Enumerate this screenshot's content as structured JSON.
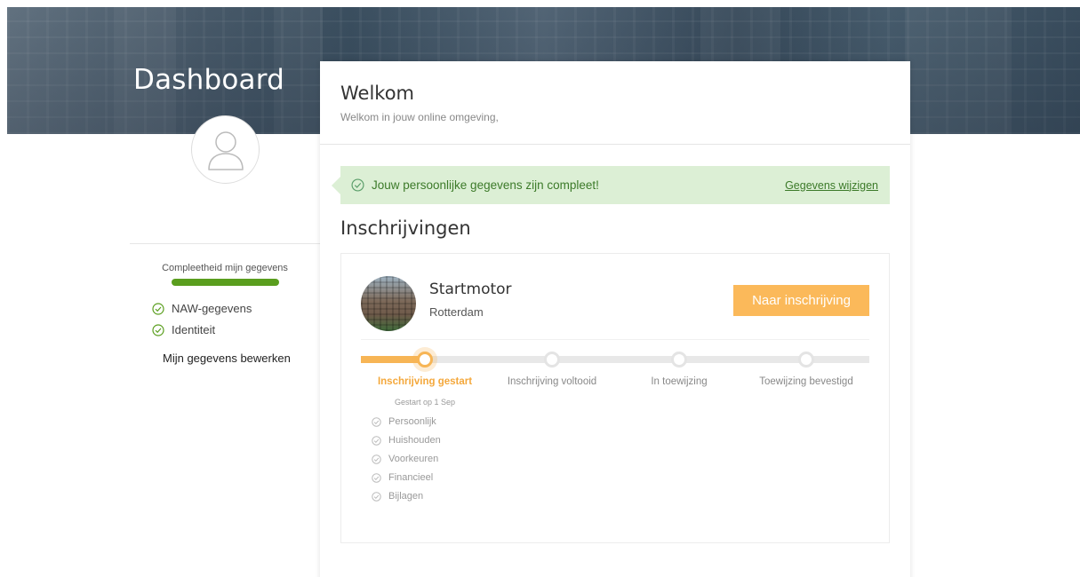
{
  "sidebar": {
    "title": "Dashboard",
    "completeness_label": "Compleetheid mijn gegevens",
    "completeness_percent": 100,
    "checks": [
      {
        "label": "NAW-gegevens",
        "icon": "check-circle-icon"
      },
      {
        "label": "Identiteit",
        "icon": "check-circle-icon"
      }
    ],
    "edit_link": "Mijn gegevens bewerken"
  },
  "welcome": {
    "title": "Welkom",
    "subtitle": "Welkom in jouw online omgeving,"
  },
  "alert": {
    "text": "Jouw persoonlijke gegevens zijn compleet!",
    "link": "Gegevens wijzigen"
  },
  "registrations": {
    "title": "Inschrijvingen",
    "items": [
      {
        "name": "Startmotor",
        "city": "Rotterdam",
        "button": "Naar inschrijving",
        "steps": [
          {
            "label": "Inschrijving gestart",
            "active": true
          },
          {
            "label": "Inschrijving voltooid",
            "active": false
          },
          {
            "label": "In toewijzing",
            "active": false
          },
          {
            "label": "Toewijzing bevestigd",
            "active": false
          }
        ],
        "started_date": "Gestart op 1 Sep",
        "progress_fraction": 0.125,
        "sub_items": [
          "Persoonlijk",
          "Huishouden",
          "Voorkeuren",
          "Financieel",
          "Bijlagen"
        ]
      }
    ]
  },
  "colors": {
    "accent": "#f7b555",
    "success": "#3c7a29",
    "success_bg": "#dcefd5",
    "progress": "#5a9e1e"
  }
}
